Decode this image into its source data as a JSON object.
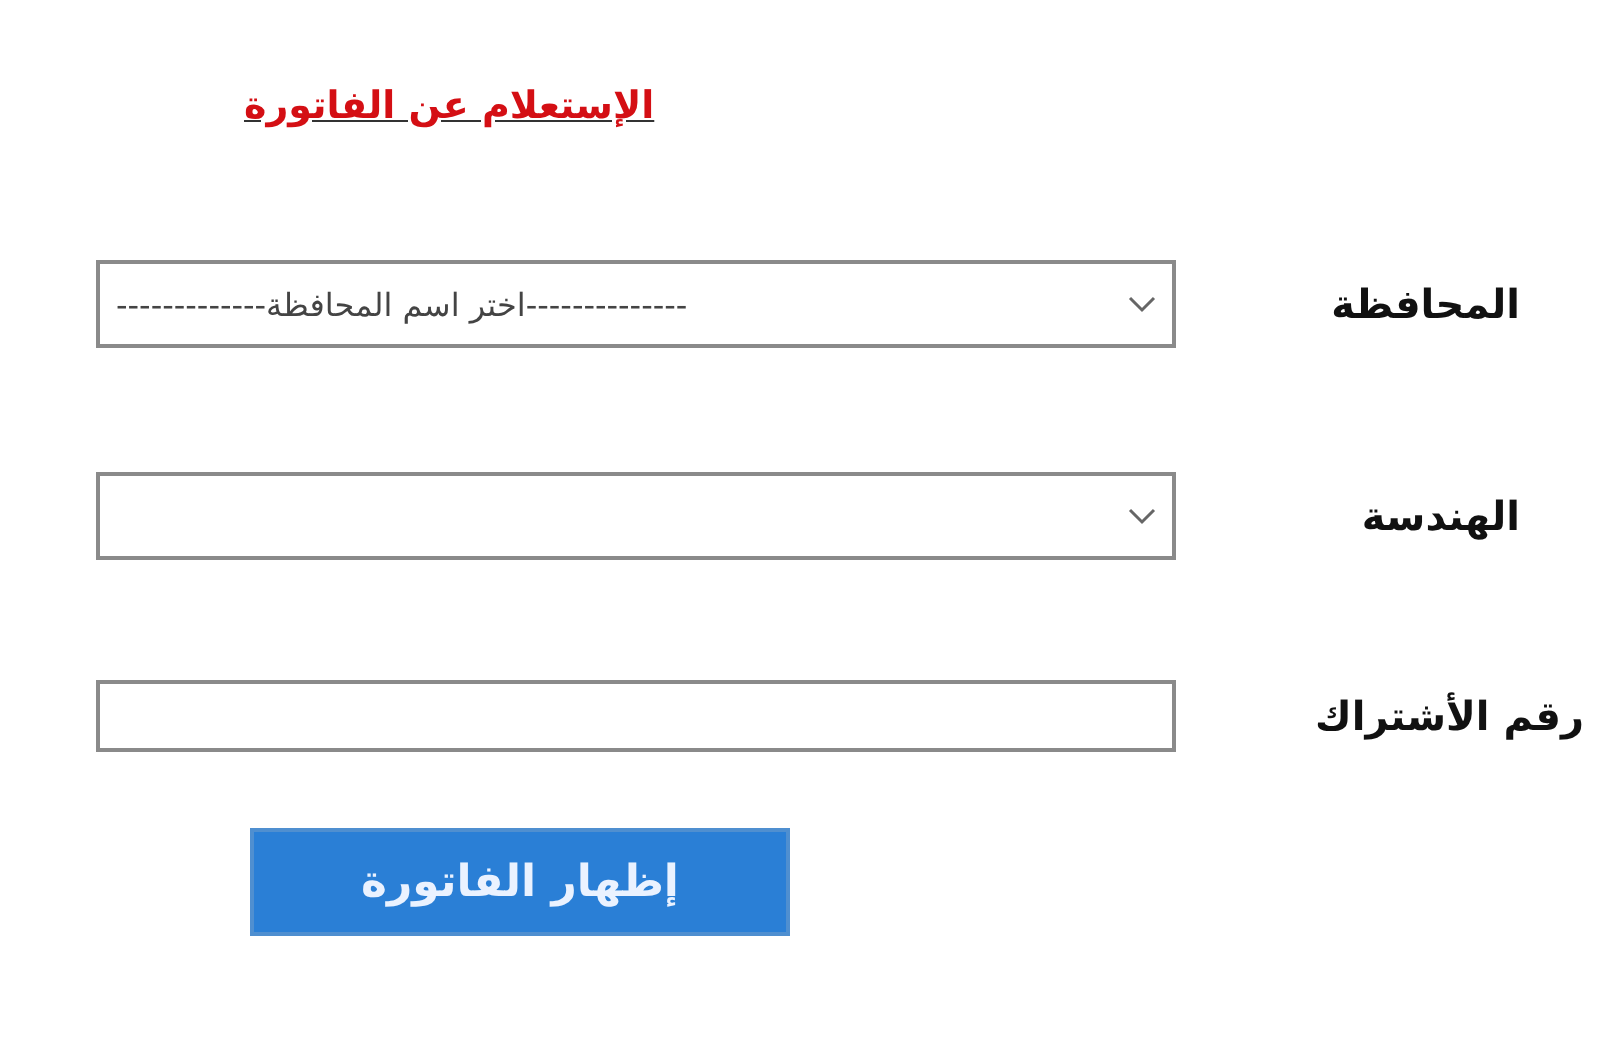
{
  "title": "الإستعلام عن الفاتورة",
  "fields": [
    {
      "kind": "select",
      "label": "المحافظة",
      "value": "--------------اختر اسم المحافظة-------------"
    },
    {
      "kind": "select",
      "label": "الهندسة"
    },
    {
      "kind": "text",
      "label": "رقم الأشتراك"
    }
  ],
  "button": "إظهار الفاتورة"
}
